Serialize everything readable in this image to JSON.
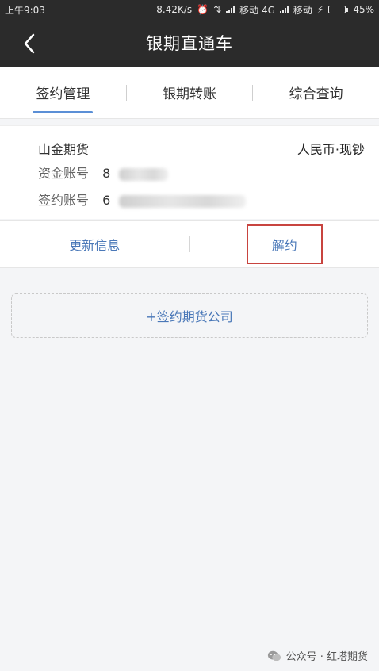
{
  "status_bar": {
    "time": "上午9:03",
    "speed": "8.42K/s",
    "carrier1": "移动 4G",
    "carrier2": "移动",
    "battery": "45%",
    "battery_level": 0.45
  },
  "header": {
    "title": "银期直通车"
  },
  "tabs": [
    {
      "label": "签约管理",
      "active": true
    },
    {
      "label": "银期转账",
      "active": false
    },
    {
      "label": "综合查询",
      "active": false
    }
  ],
  "account": {
    "company": "山金期货",
    "currency": "人民币·现钞",
    "fund_label": "资金账号",
    "fund_prefix": "8",
    "sign_label": "签约账号",
    "sign_prefix": "6"
  },
  "actions": {
    "update": "更新信息",
    "unsign": "解约"
  },
  "add_company": "+签约期货公司",
  "watermark": {
    "text": "公众号 · 红塔期货"
  },
  "colors": {
    "accent": "#4a78b8",
    "highlight": "#c8443f",
    "header_bg": "#2b2b2b"
  }
}
